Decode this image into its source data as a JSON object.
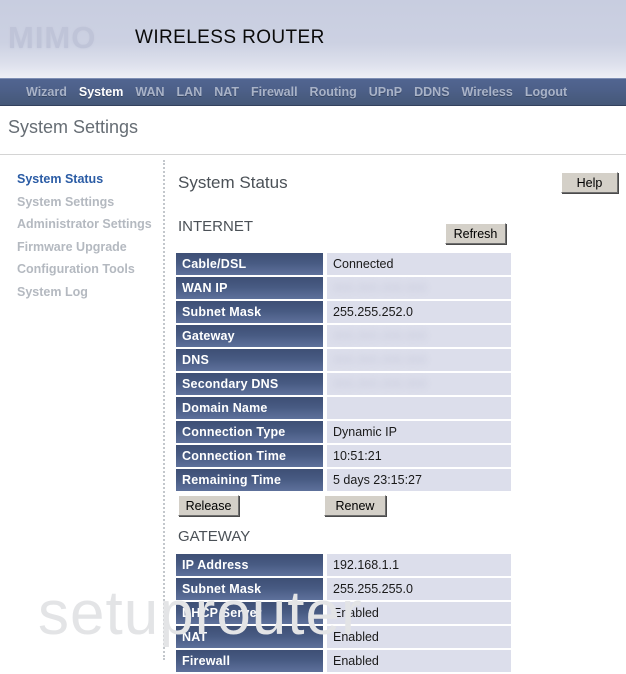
{
  "header": {
    "brand": "MIMO",
    "product": "WIRELESS ROUTER"
  },
  "nav": {
    "items": [
      {
        "label": "Wizard",
        "active": false
      },
      {
        "label": "System",
        "active": true
      },
      {
        "label": "WAN",
        "active": false
      },
      {
        "label": "LAN",
        "active": false
      },
      {
        "label": "NAT",
        "active": false
      },
      {
        "label": "Firewall",
        "active": false
      },
      {
        "label": "Routing",
        "active": false
      },
      {
        "label": "UPnP",
        "active": false
      },
      {
        "label": "DDNS",
        "active": false
      },
      {
        "label": "Wireless",
        "active": false
      },
      {
        "label": "Logout",
        "active": false
      }
    ]
  },
  "page": {
    "title": "System Settings"
  },
  "sidebar": {
    "items": [
      {
        "label": "System Status",
        "active": true
      },
      {
        "label": "System Settings",
        "active": false
      },
      {
        "label": "Administrator Settings",
        "active": false
      },
      {
        "label": "Firmware Upgrade",
        "active": false
      },
      {
        "label": "Configuration Tools",
        "active": false
      },
      {
        "label": "System Log",
        "active": false
      }
    ]
  },
  "main": {
    "heading": "System Status",
    "help_label": "Help",
    "refresh_label": "Refresh",
    "release_label": "Release",
    "renew_label": "Renew",
    "internet": {
      "heading": "INTERNET",
      "rows": [
        {
          "label": "Cable/DSL",
          "value": "Connected",
          "blurred": false
        },
        {
          "label": "WAN IP",
          "value": "000.000.000.000",
          "blurred": true
        },
        {
          "label": "Subnet Mask",
          "value": "255.255.252.0",
          "blurred": false
        },
        {
          "label": "Gateway",
          "value": "000.000.000.000",
          "blurred": true
        },
        {
          "label": "DNS",
          "value": "000.000.000.000",
          "blurred": true
        },
        {
          "label": "Secondary DNS",
          "value": "000.000.000.000",
          "blurred": true
        },
        {
          "label": "Domain Name",
          "value": "",
          "blurred": false
        },
        {
          "label": "Connection Type",
          "value": "Dynamic IP",
          "blurred": false
        },
        {
          "label": "Connection Time",
          "value": "10:51:21",
          "blurred": false
        },
        {
          "label": "Remaining Time",
          "value": "5 days 23:15:27",
          "blurred": false
        }
      ]
    },
    "gateway": {
      "heading": "GATEWAY",
      "rows": [
        {
          "label": "IP Address",
          "value": "192.168.1.1",
          "blurred": false
        },
        {
          "label": "Subnet Mask",
          "value": "255.255.255.0",
          "blurred": false
        },
        {
          "label": "DHCP Server",
          "value": "Enabled",
          "blurred": false
        },
        {
          "label": "NAT",
          "value": "Enabled",
          "blurred": false
        },
        {
          "label": "Firewall",
          "value": "Enabled",
          "blurred": false
        }
      ]
    }
  },
  "watermark": {
    "text": "setuprouter"
  }
}
